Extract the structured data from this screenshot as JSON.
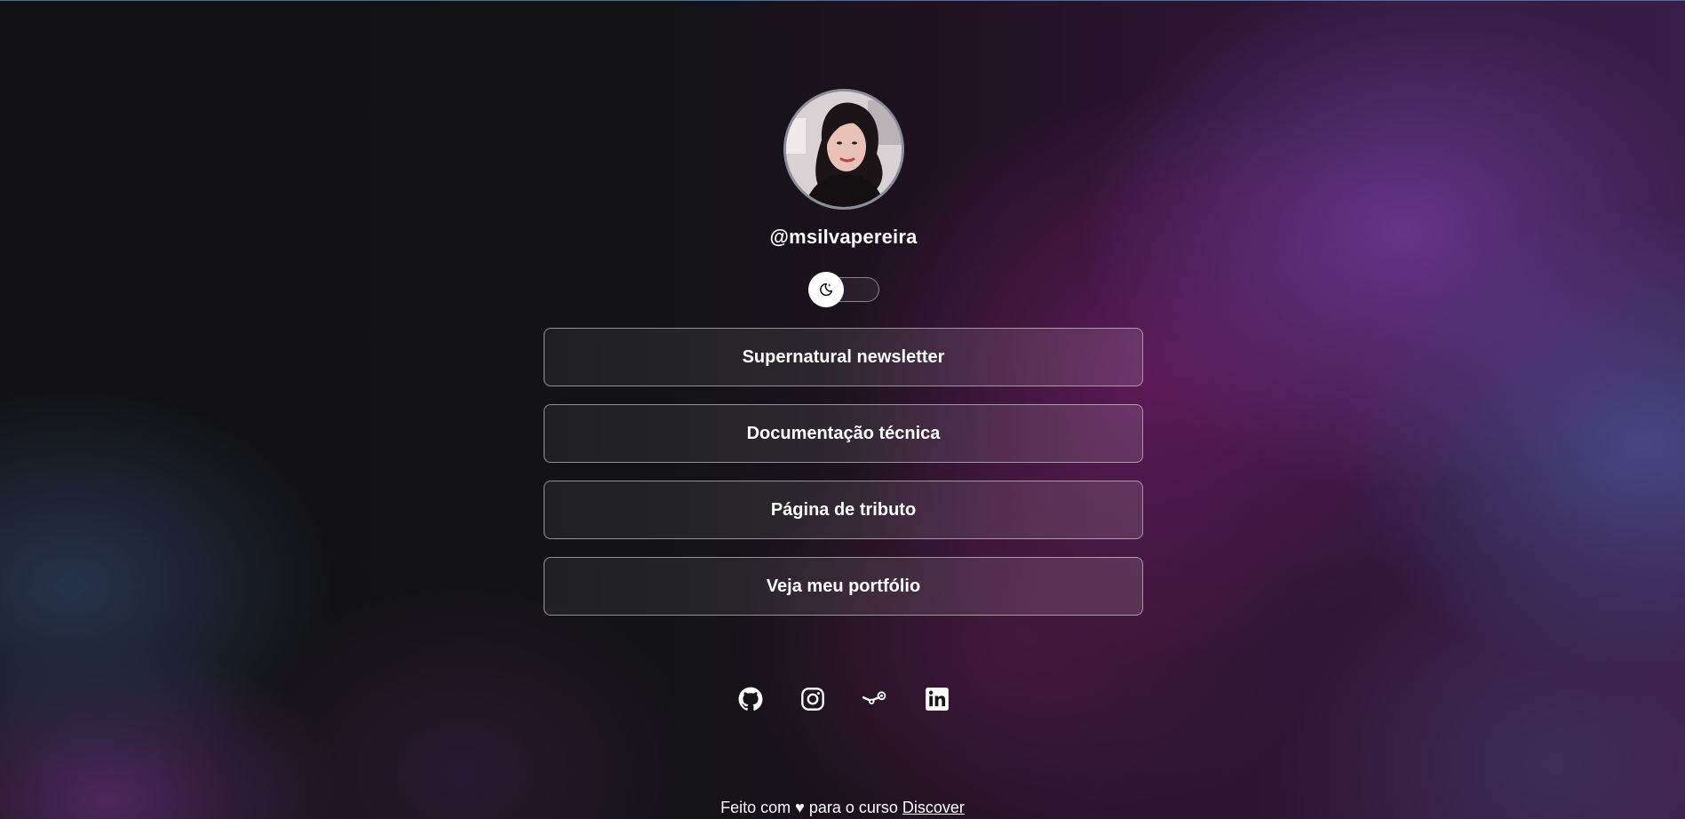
{
  "profile": {
    "username": "@msilvapereira",
    "avatar_icon": "profile-photo"
  },
  "theme_switch": {
    "icon": "moon-stars-icon",
    "state": "dark"
  },
  "links": [
    {
      "label": "Supernatural newsletter"
    },
    {
      "label": "Documentação técnica"
    },
    {
      "label": "Página de tributo"
    },
    {
      "label": "Veja meu portfólio"
    }
  ],
  "socials": [
    {
      "icon": "github-icon"
    },
    {
      "icon": "instagram-icon"
    },
    {
      "icon": "steam-icon"
    },
    {
      "icon": "linkedin-icon"
    }
  ],
  "footer": {
    "text_before": "Feito com",
    "heart": "♥",
    "text_after": "para o curso",
    "link_text": "Discover"
  },
  "colors": {
    "background_dark": "#121214",
    "accent_purple": "#6c3a96",
    "text": "#ffffff"
  }
}
